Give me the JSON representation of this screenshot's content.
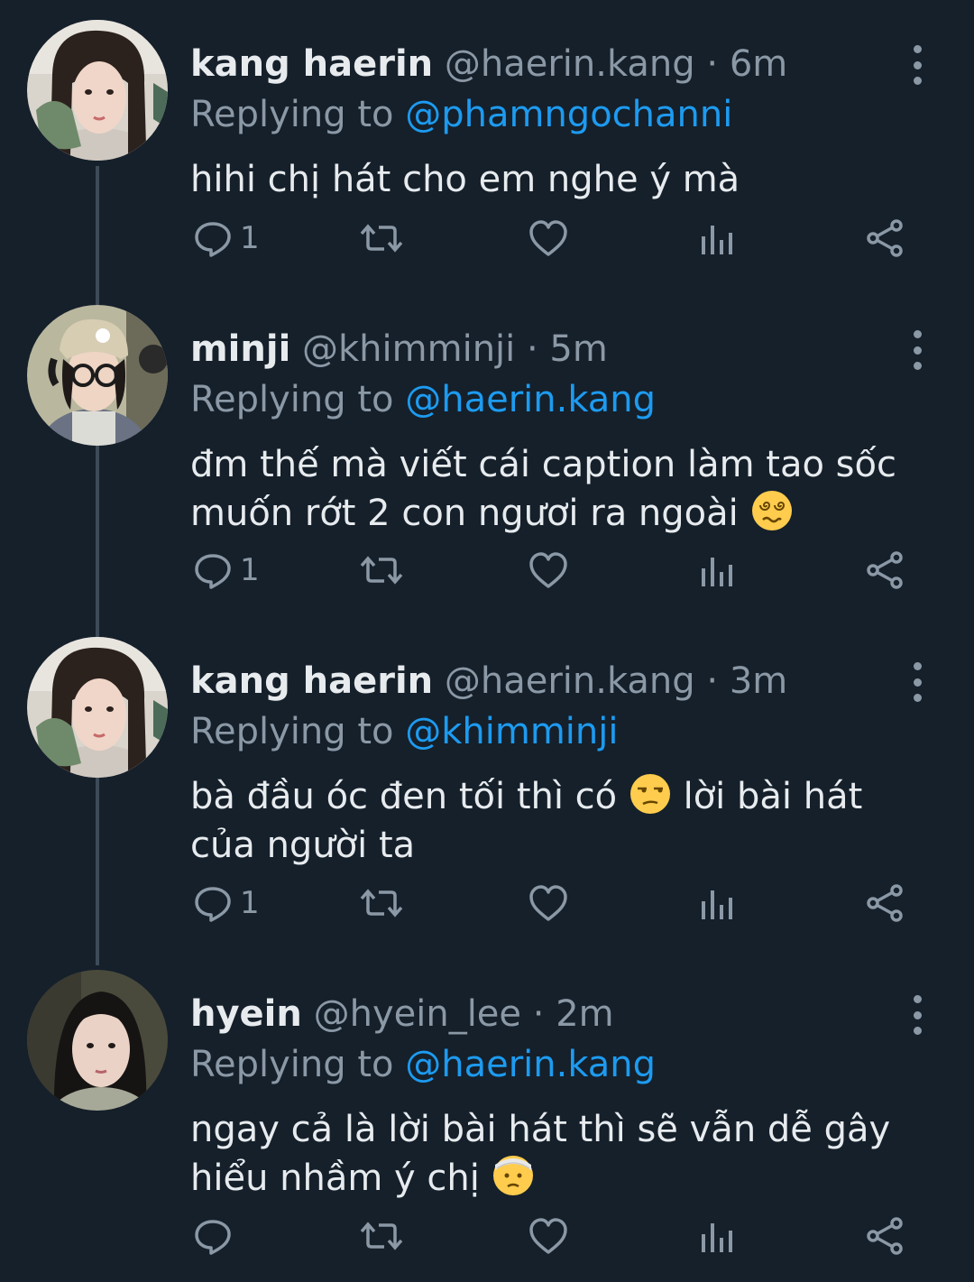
{
  "tweets": [
    {
      "name": "kang haerin",
      "handle": "@haerin.kang",
      "dot": "·",
      "time": "6m",
      "replying_label": "Replying to",
      "mention": "@phamngochanni",
      "text": "hihi chị hát cho em nghe ý mà",
      "reply_count": "1",
      "avatar_icon": "avatar-haerin"
    },
    {
      "name": "minji",
      "handle": "@khimminji",
      "dot": "·",
      "time": "5m",
      "replying_label": "Replying to",
      "mention": "@haerin.kang",
      "text": "đm thế mà viết cái caption làm tao sốc muốn rớt 2 con ngươi ra ngoài",
      "emoji": "dizzy-face",
      "reply_count": "1",
      "avatar_icon": "avatar-minji"
    },
    {
      "name": "kang haerin",
      "handle": "@haerin.kang",
      "dot": "·",
      "time": "3m",
      "replying_label": "Replying to",
      "mention": "@khimminji",
      "text_before": "bà đầu óc đen tối thì có",
      "emoji": "unamused-face",
      "text_after": "lời bài hát của người ta",
      "reply_count": "1",
      "avatar_icon": "avatar-haerin"
    },
    {
      "name": "hyein",
      "handle": "@hyein_lee",
      "dot": "·",
      "time": "2m",
      "replying_label": "Replying to",
      "mention": "@haerin.kang",
      "text": "ngay cả là lời bài hát thì sẽ vẫn dễ gây hiểu nhầm ý chị",
      "emoji": "bandaged-face",
      "reply_count": "",
      "avatar_icon": "avatar-hyein"
    }
  ],
  "icons": [
    "reply-icon",
    "retweet-icon",
    "like-icon",
    "views-icon",
    "share-icon",
    "more-icon"
  ],
  "colors": {
    "background": "#15202b",
    "text": "#e7ebee",
    "muted": "#8b98a5",
    "mention": "#1d9bf0",
    "thread_line": "#3d4a57"
  }
}
